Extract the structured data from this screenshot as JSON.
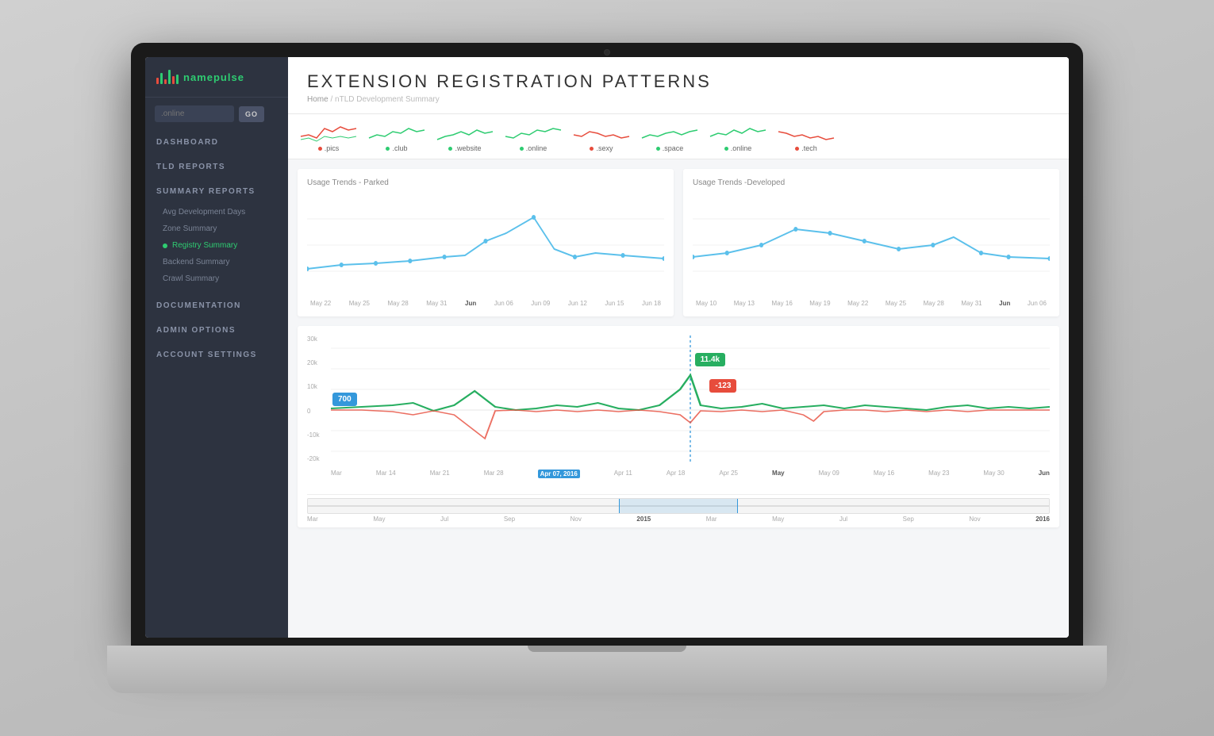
{
  "app": {
    "name": "name",
    "name_accent": "pulse",
    "camera_dot": true
  },
  "search": {
    "placeholder": ".online",
    "go_label": "GO"
  },
  "nav": {
    "items": [
      {
        "id": "dashboard",
        "label": "DASHBOARD"
      },
      {
        "id": "tld-reports",
        "label": "TLD REPORTS"
      },
      {
        "id": "summary-reports",
        "label": "SUMMARY REPORTS"
      }
    ],
    "sub_items": [
      {
        "id": "avg-dev-days",
        "label": "Avg Development Days",
        "active": false
      },
      {
        "id": "zone-summary",
        "label": "Zone Summary",
        "active": false
      },
      {
        "id": "registry-summary",
        "label": "Registry Summary",
        "active": true
      },
      {
        "id": "backend-summary",
        "label": "Backend Summary",
        "active": false
      },
      {
        "id": "crawl-summary",
        "label": "Crawl Summary",
        "active": false
      }
    ],
    "bottom_items": [
      {
        "id": "documentation",
        "label": "DOCUMENTATION"
      },
      {
        "id": "admin-options",
        "label": "ADMIN OPTIONS"
      },
      {
        "id": "account-settings",
        "label": "ACCOUNT SETTINGS"
      }
    ]
  },
  "page": {
    "title": "EXTENSION REGISTRATION PATTERNS",
    "breadcrumb_home": "Home",
    "breadcrumb_sep": "/",
    "breadcrumb_current": "nTLD Development Summary"
  },
  "mini_charts": [
    {
      "label": ".pics",
      "color": "#e74c3c"
    },
    {
      "label": ".club",
      "color": "#2ecc71"
    },
    {
      "label": ".website",
      "color": "#2ecc71"
    },
    {
      "label": ".online",
      "color": "#2ecc71"
    },
    {
      "label": ".sexy",
      "color": "#e74c3c"
    },
    {
      "label": ".space",
      "color": "#2ecc71"
    },
    {
      "label": ".online",
      "color": "#2ecc71"
    },
    {
      "label": ".tech",
      "color": "#e74c3c"
    }
  ],
  "charts": {
    "parked_title": "Usage Trends - Parked",
    "developed_title": "Usage Trends -Developed",
    "parked_x_labels": [
      "May 22",
      "May 25",
      "May 28",
      "May 31",
      "Jun",
      "Jun 06",
      "Jun 09",
      "Jun 12",
      "Jun 15",
      "Jun 18"
    ],
    "developed_x_labels": [
      "May 10",
      "May 13",
      "May 16",
      "May 19",
      "May 22",
      "May 25",
      "May 28",
      "May 31",
      "Jun",
      "Jun 06"
    ],
    "bottom_title": "",
    "bottom_x_labels": [
      "Mar",
      "Mar 14",
      "Mar 21",
      "Mar 28",
      "Apr 07, 2016",
      "Apr 11",
      "Apr 18",
      "Apr 25",
      "May",
      "May 09",
      "May 16",
      "May 23",
      "May 30",
      "Jun"
    ],
    "bottom_x2_labels": [
      "Mar",
      "",
      "May",
      "",
      "Jul",
      "",
      "Sep",
      "",
      "Nov",
      "2015",
      "Mar",
      "",
      "May",
      "",
      "Jul",
      "",
      "Sep",
      "",
      "Nov",
      "2016"
    ],
    "y_labels_bottom": [
      "30k",
      "20k",
      "10k",
      "0",
      "-10k",
      "-20k"
    ],
    "tooltip_green": "11.4k",
    "tooltip_red": "-123",
    "tooltip_blue": "700"
  }
}
